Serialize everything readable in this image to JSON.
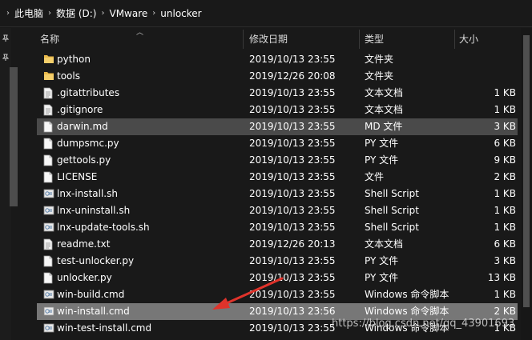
{
  "breadcrumb": [
    "此电脑",
    "数据 (D:)",
    "VMware",
    "unlocker"
  ],
  "columns": {
    "name": "名称",
    "date": "修改日期",
    "type": "类型",
    "size": "大小"
  },
  "files": [
    {
      "name": "python",
      "date": "2019/10/13 23:55",
      "type": "文件夹",
      "size": "",
      "icon": "folder-icon"
    },
    {
      "name": "tools",
      "date": "2019/12/26 20:08",
      "type": "文件夹",
      "size": "",
      "icon": "folder-icon"
    },
    {
      "name": ".gitattributes",
      "date": "2019/10/13 23:55",
      "type": "文本文档",
      "size": "1 KB",
      "icon": "text-file-icon"
    },
    {
      "name": ".gitignore",
      "date": "2019/10/13 23:55",
      "type": "文本文档",
      "size": "1 KB",
      "icon": "text-file-icon"
    },
    {
      "name": "darwin.md",
      "date": "2019/10/13 23:55",
      "type": "MD 文件",
      "size": "3 KB",
      "icon": "file-icon",
      "state": "selected"
    },
    {
      "name": "dumpsmc.py",
      "date": "2019/10/13 23:55",
      "type": "PY 文件",
      "size": "6 KB",
      "icon": "file-icon"
    },
    {
      "name": "gettools.py",
      "date": "2019/10/13 23:55",
      "type": "PY 文件",
      "size": "9 KB",
      "icon": "file-icon"
    },
    {
      "name": "LICENSE",
      "date": "2019/10/13 23:55",
      "type": "文件",
      "size": "2 KB",
      "icon": "file-icon"
    },
    {
      "name": "lnx-install.sh",
      "date": "2019/10/13 23:55",
      "type": "Shell Script",
      "size": "1 KB",
      "icon": "script-icon"
    },
    {
      "name": "lnx-uninstall.sh",
      "date": "2019/10/13 23:55",
      "type": "Shell Script",
      "size": "1 KB",
      "icon": "script-icon"
    },
    {
      "name": "lnx-update-tools.sh",
      "date": "2019/10/13 23:55",
      "type": "Shell Script",
      "size": "1 KB",
      "icon": "script-icon"
    },
    {
      "name": "readme.txt",
      "date": "2019/12/26 20:13",
      "type": "文本文档",
      "size": "6 KB",
      "icon": "text-file-icon"
    },
    {
      "name": "test-unlocker.py",
      "date": "2019/10/13 23:55",
      "type": "PY 文件",
      "size": "3 KB",
      "icon": "file-icon"
    },
    {
      "name": "unlocker.py",
      "date": "2019/10/13 23:55",
      "type": "PY 文件",
      "size": "13 KB",
      "icon": "file-icon"
    },
    {
      "name": "win-build.cmd",
      "date": "2019/10/13 23:55",
      "type": "Windows 命令脚本",
      "size": "1 KB",
      "icon": "script-icon"
    },
    {
      "name": "win-install.cmd",
      "date": "2019/10/13 23:56",
      "type": "Windows 命令脚本",
      "size": "2 KB",
      "icon": "script-icon",
      "state": "highlighted"
    },
    {
      "name": "win-test-install.cmd",
      "date": "2019/10/13 23:55",
      "type": "Windows 命令脚本",
      "size": "1 KB",
      "icon": "script-icon"
    }
  ],
  "watermark": "https://blog.csdn.net/qq_43901693",
  "colors": {
    "background": "#191919",
    "selected_row": "#4a4a4a",
    "highlight_row": "#777777",
    "folder": "#e8b84a",
    "arrow": "#e0332b"
  }
}
